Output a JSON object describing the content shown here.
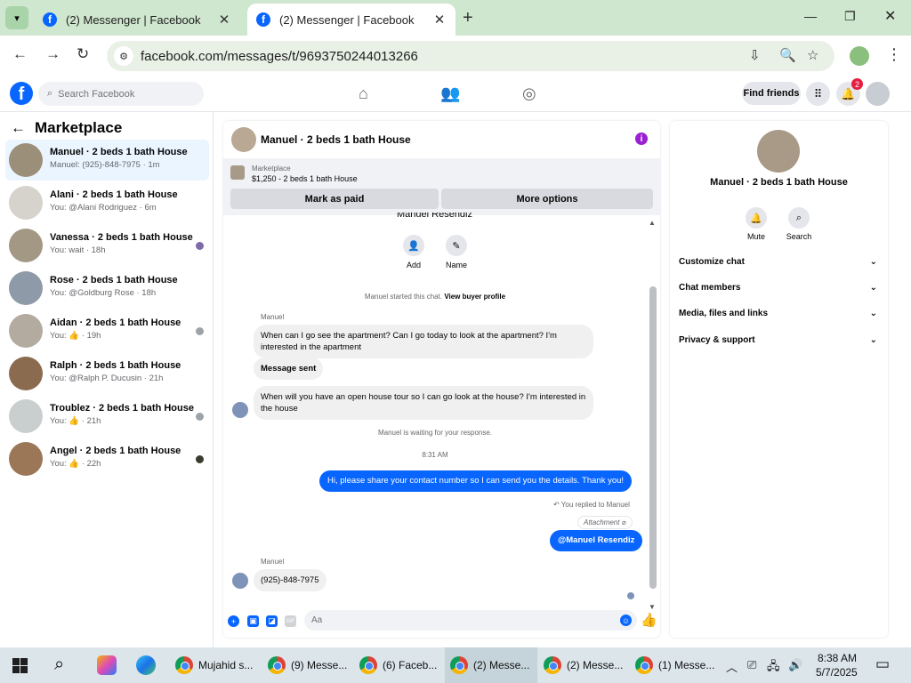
{
  "browser": {
    "tabs": [
      {
        "title": "(2) Messenger | Facebook",
        "active": false
      },
      {
        "title": "(2) Messenger | Facebook",
        "active": true
      }
    ],
    "url": "facebook.com/messages/t/9693750244013266"
  },
  "fb": {
    "search_placeholder": "Search Facebook",
    "find_friends": "Find friends",
    "notif_count": "2",
    "brand_color": "#0866ff"
  },
  "sidebar": {
    "title": "Marketplace",
    "conversations": [
      {
        "name": "Manuel · 2 beds 1 bath House",
        "snippet": "Manuel: (925)-848-7975 · 1m",
        "selected": true
      },
      {
        "name": "Alani · 2 beds 1 bath House",
        "snippet": "You: @Alani Rodriguez · 6m"
      },
      {
        "name": "Vanessa · 2 beds 1 bath House",
        "snippet": "You: wait · 18h"
      },
      {
        "name": "Rose · 2 beds 1 bath House",
        "snippet": "You: @Goldburg Rose · 18h"
      },
      {
        "name": "Aidan · 2 beds 1 bath House",
        "snippet": "You: 👍 · 19h"
      },
      {
        "name": "Ralph · 2 beds 1 bath House",
        "snippet": "You: @Ralph P. Ducusin · 21h"
      },
      {
        "name": "Troublez · 2 beds 1 bath House",
        "snippet": "You: 👍 · 21h"
      },
      {
        "name": "Angel · 2 beds 1 bath House",
        "snippet": "You: 👍 · 22h"
      }
    ]
  },
  "chat": {
    "title": "Manuel · 2 beds 1 bath House",
    "marketplace_label": "Marketplace",
    "listing": "$1,250 - 2 beds 1 bath House",
    "mark_paid": "Mark as paid",
    "more_options": "More options",
    "profile_name_cut": "Manuel Resendiz",
    "actions": {
      "add": "Add",
      "name": "Name"
    },
    "started_text": "Manuel started this chat.",
    "view_profile": "View buyer profile",
    "sender_1": "Manuel",
    "msg_1": "When can I go see the apartment? Can I go today to look at the apartment? I'm interested in the apartment",
    "msg_2": "Message sent",
    "msg_3": "When will you have an open house tour so I can go look at the house? I'm interested in the house",
    "waiting": "Manuel is waiting for your response.",
    "time": "8:31 AM",
    "out_1": "Hi, please share your contact number so I can send you the details. Thank you!",
    "replied": "You replied to Manuel",
    "attachment": "Attachment",
    "out_2": "@Manuel Resendiz",
    "sender_2": "Manuel",
    "msg_4": "(925)-848-7975",
    "composer_placeholder": "Aa",
    "composer_icons": [
      "plus-icon",
      "photo-icon",
      "sticker-icon",
      "gif-icon"
    ],
    "gif_label": "GIF"
  },
  "info": {
    "name": "Manuel · 2 beds 1 bath House",
    "mute": "Mute",
    "search": "Search",
    "sections": [
      "Customize chat",
      "Chat members",
      "Media, files and links",
      "Privacy & support"
    ]
  },
  "taskbar": {
    "items": [
      {
        "label": "Mujahid s...",
        "active": false
      },
      {
        "label": "(9) Messe...",
        "active": false
      },
      {
        "label": "(6) Faceb...",
        "active": false
      },
      {
        "label": "(2) Messe...",
        "active": true
      },
      {
        "label": "(2) Messe...",
        "active": false
      },
      {
        "label": "(1) Messe...",
        "active": false
      }
    ],
    "time": "8:38 AM",
    "date": "5/7/2025"
  }
}
